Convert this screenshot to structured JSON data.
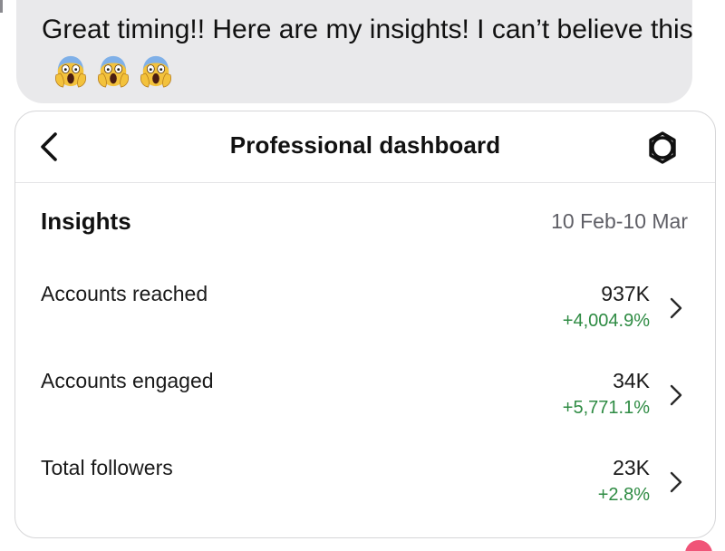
{
  "message": {
    "text": "Great timing!! Here are my insights! I can’t believe this",
    "emojis": [
      "screaming-face",
      "screaming-face",
      "screaming-face"
    ]
  },
  "dashboard": {
    "title": "Professional dashboard",
    "back_icon": "chevron-left-icon",
    "settings_icon": "settings-ring-icon"
  },
  "insights": {
    "title": "Insights",
    "date_range": "10 Feb-10 Mar",
    "metrics": [
      {
        "label": "Accounts reached",
        "value": "937K",
        "change": "+4,004.9%"
      },
      {
        "label": "Accounts engaged",
        "value": "34K",
        "change": "+5,771.1%"
      },
      {
        "label": "Total followers",
        "value": "23K",
        "change": "+2.8%"
      }
    ]
  },
  "colors": {
    "bubble": "#e9e9eb",
    "positive_change": "#2e8b43",
    "secondary_text": "#5f5f66"
  }
}
